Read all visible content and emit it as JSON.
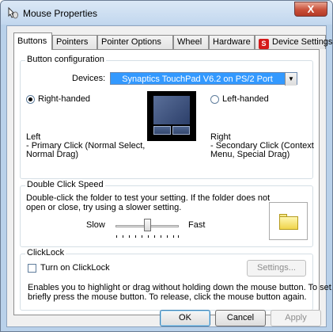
{
  "window": {
    "title": "Mouse Properties",
    "close_label": "X"
  },
  "tabs": [
    {
      "label": "Buttons"
    },
    {
      "label": "Pointers"
    },
    {
      "label": "Pointer Options"
    },
    {
      "label": "Wheel"
    },
    {
      "label": "Hardware"
    },
    {
      "label": "Device Settings"
    }
  ],
  "button_config": {
    "title": "Button configuration",
    "devices_label": "Devices:",
    "devices_value": "Synaptics TouchPad V6.2 on PS/2 Port",
    "right_handed_label": "Right-handed",
    "left_handed_label": "Left-handed",
    "right_handed_selected": true,
    "left_text": "Left",
    "left_desc_line1": "- Primary Click (Normal Select,",
    "left_desc_line2": "Normal Drag)",
    "right_text": "Right",
    "right_desc_line1": "- Secondary Click (Context",
    "right_desc_line2": "Menu, Special Drag)"
  },
  "double_click": {
    "title": "Double Click Speed",
    "desc_line1": "Double-click the folder to test your setting.  If the folder does not",
    "desc_line2": "open or close, try using a slower setting.",
    "slow_label": "Slow",
    "fast_label": "Fast",
    "speed_level": 0.5
  },
  "clicklock": {
    "title": "ClickLock",
    "checkbox_label": "Turn on ClickLock",
    "checked": false,
    "settings_label": "Settings...",
    "desc_line1": "Enables you to highlight or drag without holding down the mouse button.  To set,",
    "desc_line2": "briefly press the mouse button.  To release, click the mouse button again."
  },
  "buttons": {
    "ok": "OK",
    "cancel": "Cancel",
    "apply": "Apply"
  }
}
